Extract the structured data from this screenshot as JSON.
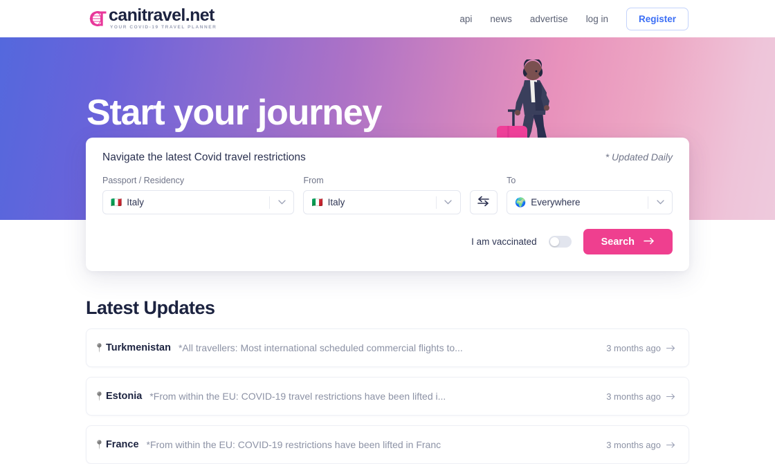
{
  "header": {
    "logo": {
      "word": "canitravel.net",
      "tagline": "YOUR COVID-19 TRAVEL PLANNER"
    },
    "nav": [
      {
        "label": "api"
      },
      {
        "label": "news"
      },
      {
        "label": "advertise"
      },
      {
        "label": "log in"
      }
    ],
    "register_label": "Register"
  },
  "hero": {
    "title": "Start your journey"
  },
  "search_card": {
    "heading": "Navigate the latest Covid travel restrictions",
    "updated_note": "* Updated Daily",
    "passport": {
      "label": "Passport / Residency",
      "flag": "🇮🇹",
      "value": "Italy"
    },
    "from": {
      "label": "From",
      "flag": "🇮🇹",
      "value": "Italy"
    },
    "to": {
      "label": "To",
      "flag": "🌍",
      "value": "Everywhere"
    },
    "vaccinated_label": "I am vaccinated",
    "vaccinated_on": false,
    "search_label": "Search"
  },
  "updates": {
    "title": "Latest Updates",
    "rows": [
      {
        "country": "Turkmenistan",
        "snippet": "*All travellers: Most international scheduled commercial flights to...",
        "ago": "3 months ago"
      },
      {
        "country": "Estonia",
        "snippet": "*From within the EU: COVID-19 travel restrictions have been lifted i...",
        "ago": "3 months ago"
      },
      {
        "country": "France",
        "snippet": "*From within the EU: COVID-19 restrictions have been lifted in Franc",
        "ago": "3 months ago"
      }
    ]
  },
  "colors": {
    "accent_pink": "#ef3f8f",
    "accent_blue": "#3b6ef5",
    "hero_from": "#5468dd",
    "hero_to": "#eecadd",
    "ink": "#1c2340"
  }
}
